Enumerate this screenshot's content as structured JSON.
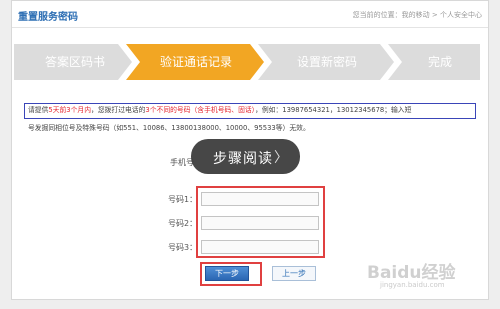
{
  "header": {
    "title": "重置服务密码",
    "crumb": "您当前的位置：我的移动 > 个人安全中心"
  },
  "steps": [
    {
      "label": "答案区码书",
      "state": "done"
    },
    {
      "label": "验证通话记录",
      "state": "active"
    },
    {
      "label": "设置新密码",
      "state": "todo"
    },
    {
      "label": "完成",
      "state": "todo"
    }
  ],
  "notice": {
    "part1": "请提供",
    "highlight1": "5天前3个月内",
    "part2": "，您拨打过电话的",
    "highlight2": "3个不同的号码（含手机号码、固话）",
    "part3": "，例如：13987654321，13012345678；输入短",
    "line2": "号发掘同相位号及特殊号码（如551、10086、13800138000、10000、95533等）无效。"
  },
  "form": {
    "phone_label": "手机号",
    "number_labels": [
      "号码1：",
      "号码2：",
      "号码3："
    ],
    "number_values": [
      "",
      "",
      ""
    ],
    "next_label": "下一步",
    "prev_label": "上一步"
  },
  "overlay": {
    "text": "步骤阅读",
    "chevron": "〉"
  },
  "watermark": {
    "text": "Baidu经验",
    "sub": "jingyan.baidu.com"
  },
  "colors": {
    "accent": "#2e6fb4",
    "step_active": "#f2a623",
    "step_inactive": "#dcdcdc",
    "highlight_red": "#e6262f",
    "notice_border": "#3a45b8"
  }
}
